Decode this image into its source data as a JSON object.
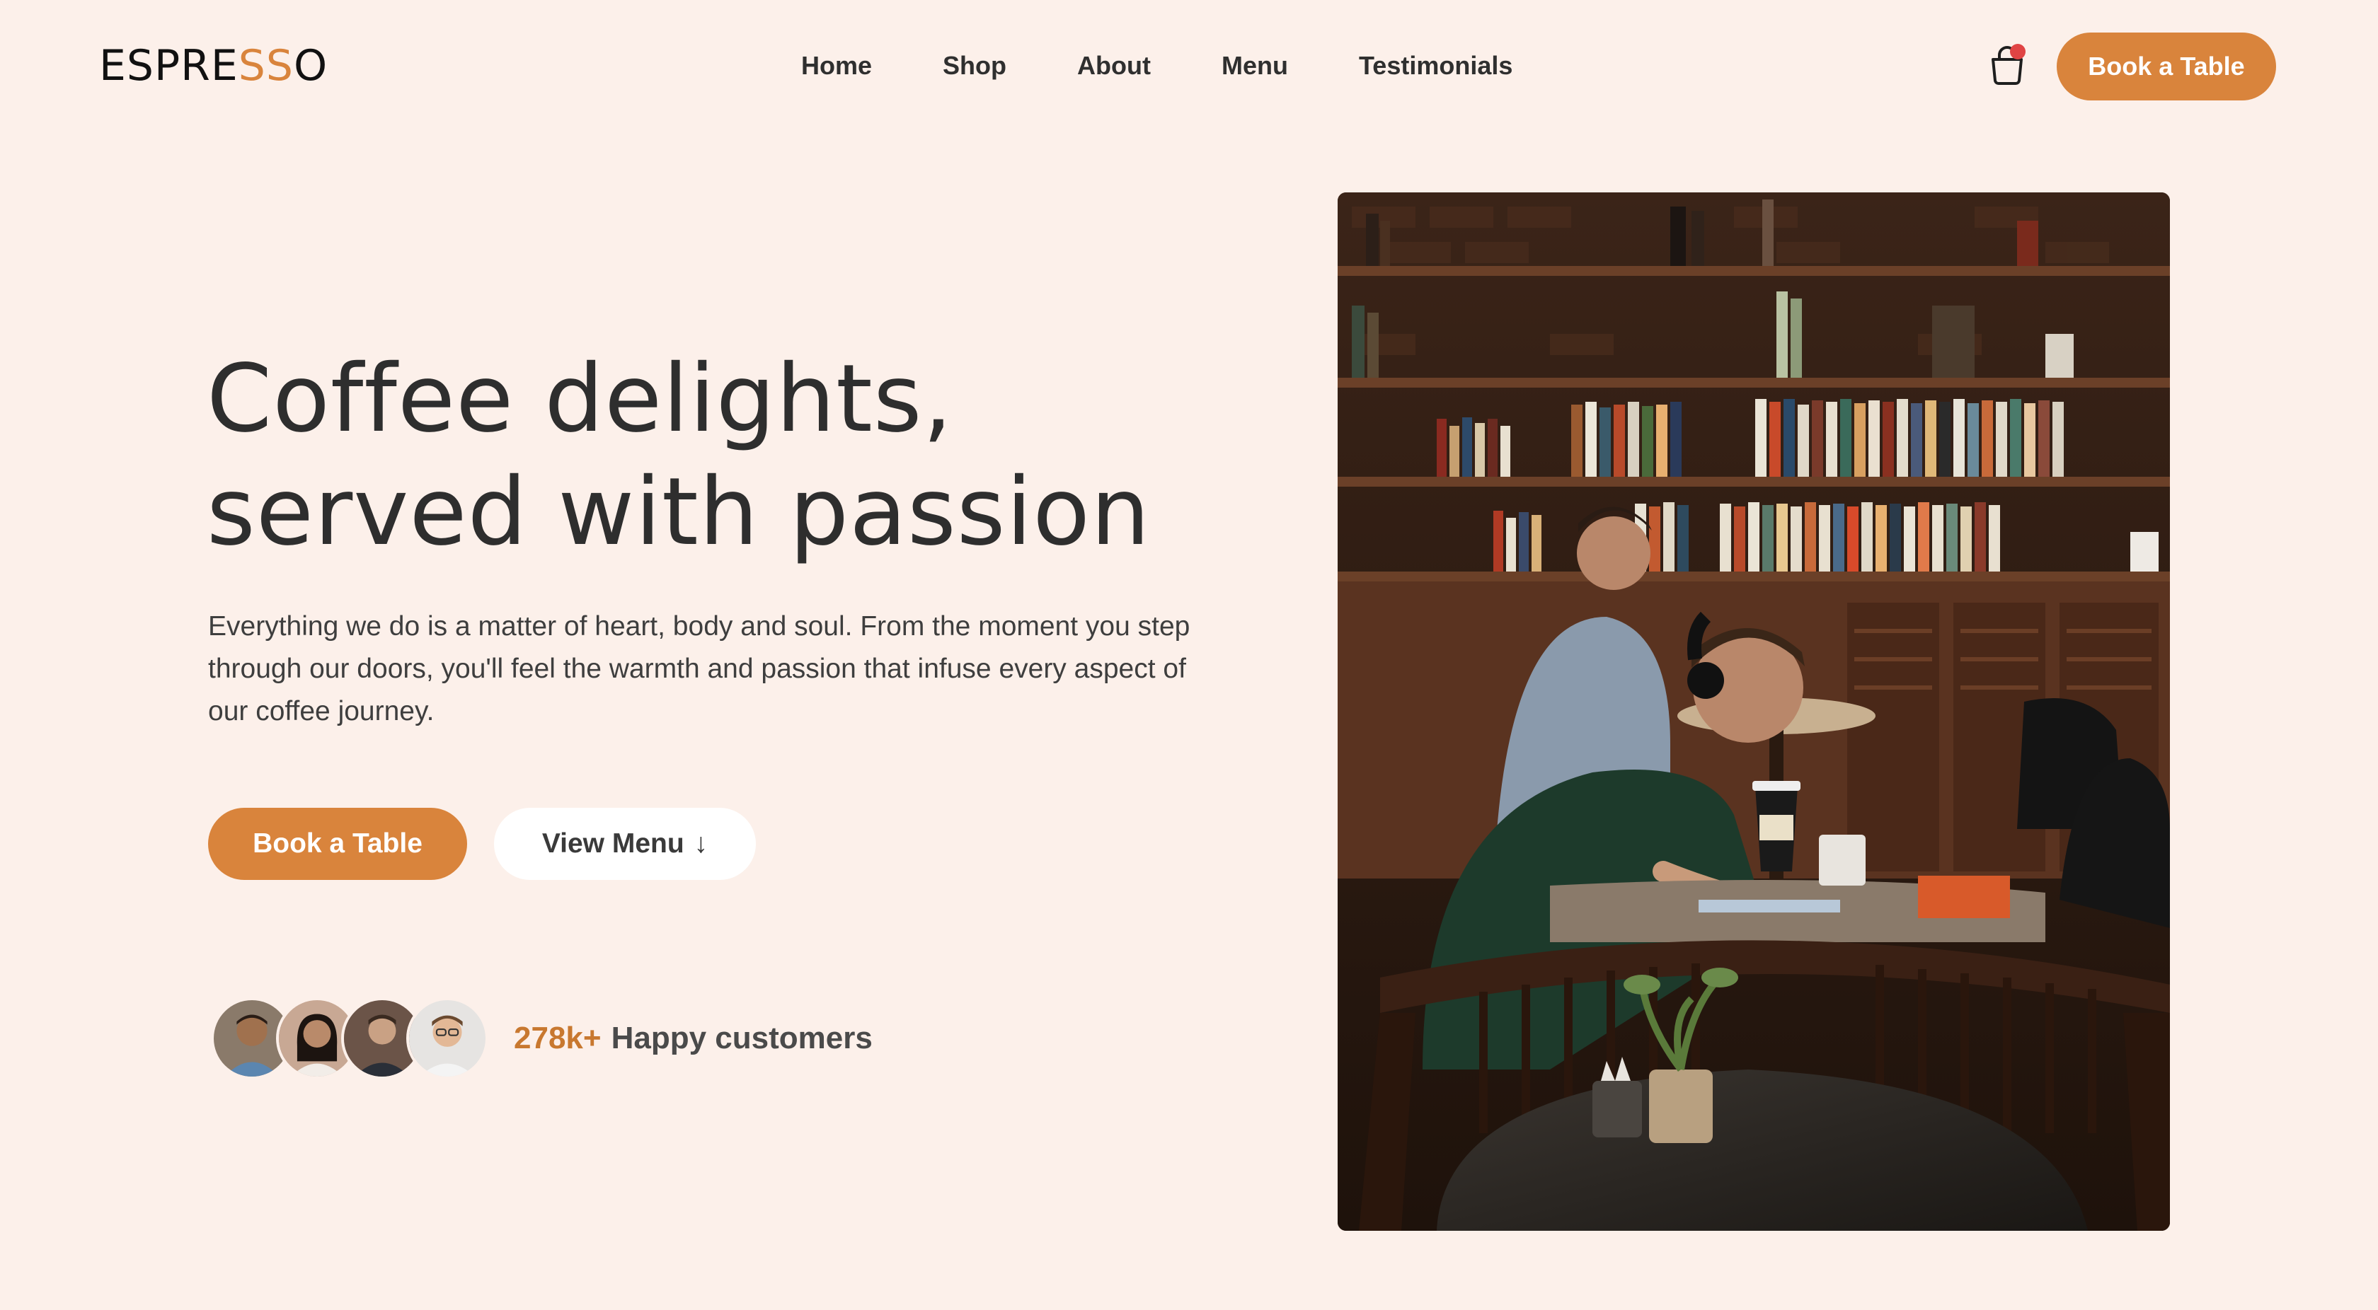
{
  "header": {
    "logo": {
      "part1": "ESPRE",
      "part2": "SS",
      "part3": "O"
    },
    "nav": [
      {
        "label": "Home"
      },
      {
        "label": "Shop"
      },
      {
        "label": "About"
      },
      {
        "label": "Menu"
      },
      {
        "label": "Testimonials"
      }
    ],
    "cart_icon": "shopping-bag-icon",
    "cta_label": "Book a Table"
  },
  "hero": {
    "title_line1": "Coffee delights,",
    "title_line2": "served with passion",
    "description": "Everything we do is a matter of heart, body and soul. From the moment you step through our doors, you'll feel the warmth and passion that infuse every aspect of our coffee journey.",
    "primary_button": "Book a Table",
    "secondary_button": "View Menu",
    "secondary_button_icon": "↓",
    "customers_count": "278k+",
    "customers_label": "Happy customers"
  },
  "colors": {
    "background": "#fcf0ea",
    "accent": "#d9843c",
    "text": "#2e2e2e",
    "notification": "#e04444"
  }
}
